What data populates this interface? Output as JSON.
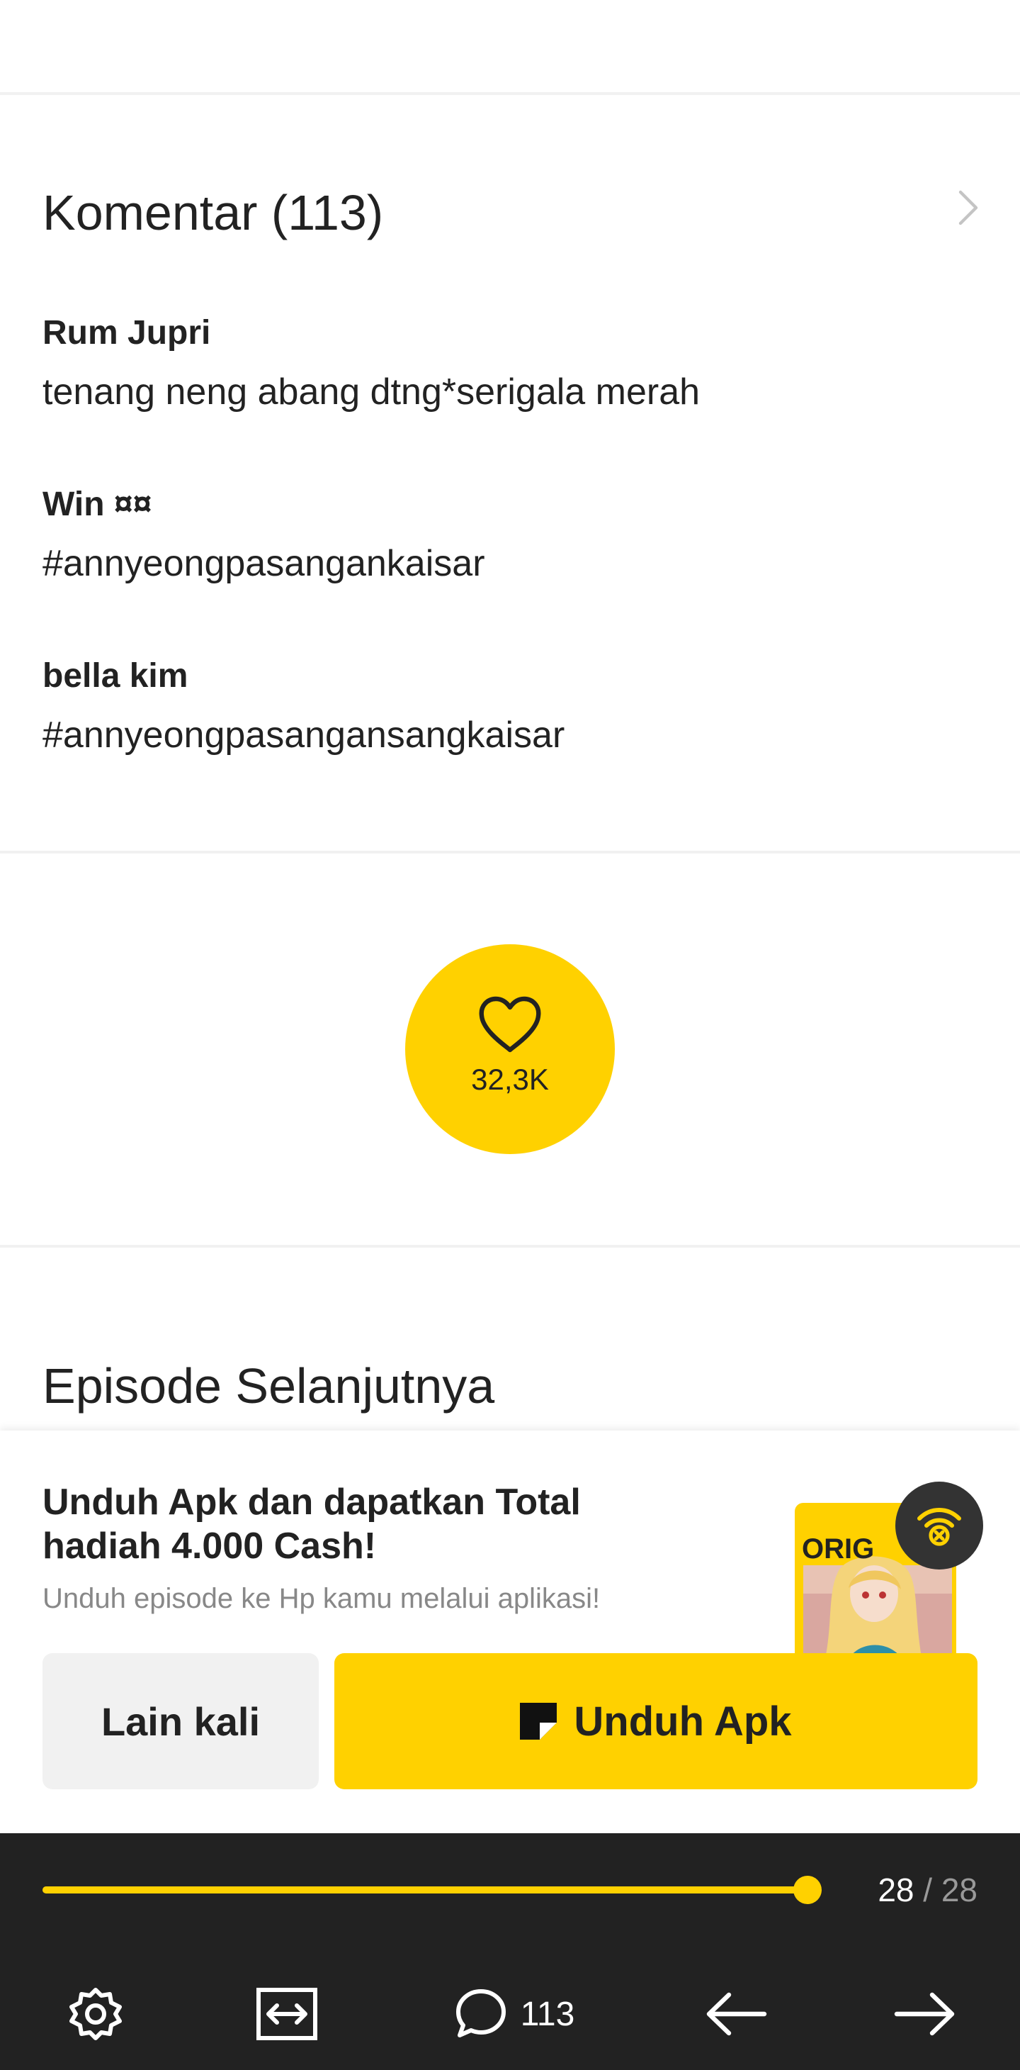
{
  "comments": {
    "title": "Komentar (113)",
    "items": [
      {
        "author": "Rum Jupri",
        "text": "tenang neng abang dtng*serigala merah"
      },
      {
        "author": "Win ¤¤",
        "text": "#annyeongpasangankaisar"
      },
      {
        "author": "bella kim",
        "text": "#annyeongpasangansangkaisar"
      }
    ]
  },
  "like": {
    "count": "32,3K"
  },
  "next_episode": {
    "title": "Episode Selanjutnya"
  },
  "download_sheet": {
    "title": "Unduh Apk dan dapatkan Total hadiah 4.000 Cash!",
    "subtitle": "Unduh episode ke Hp kamu melalui aplikasi!",
    "art_label": "ORIG",
    "later_label": "Lain kali",
    "download_label": "Unduh Apk"
  },
  "toolbar": {
    "progress": 1.0,
    "page_current": "28",
    "page_separator": "/",
    "page_total": "28",
    "comment_count": "113"
  },
  "colors": {
    "accent": "#ffd100",
    "toolbar_bg": "#222222",
    "text": "#222222",
    "muted": "#888888"
  }
}
